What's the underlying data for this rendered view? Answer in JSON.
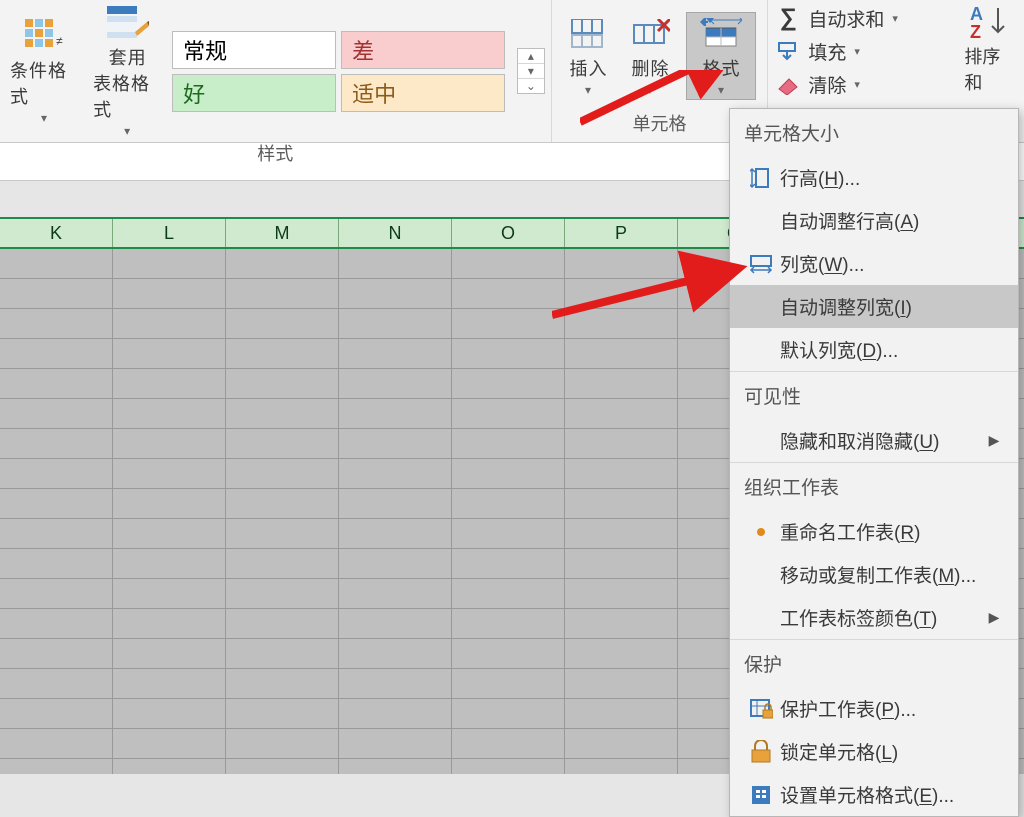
{
  "ribbon": {
    "cond_format_label": "条件格式",
    "table_format_label": "套用",
    "table_format_label2": "表格格式",
    "style_normal": "常规",
    "style_bad": "差",
    "style_good": "好",
    "style_mid": "适中",
    "styles_group_label": "样式",
    "insert_label": "插入",
    "delete_label": "删除",
    "format_label": "格式",
    "cells_group_label": "单元格",
    "autosum_label": "自动求和",
    "fill_label": "填充",
    "clear_label": "清除",
    "sort_label": "排序和"
  },
  "columns": [
    "K",
    "L",
    "M",
    "N",
    "O",
    "P",
    "Q"
  ],
  "menu": {
    "section_cellsize": "单元格大小",
    "row_height": "行高(H)...",
    "autofit_row": "自动调整行高(A)",
    "col_width": "列宽(W)...",
    "autofit_col": "自动调整列宽(I)",
    "default_width": "默认列宽(D)...",
    "section_visibility": "可见性",
    "hide_unhide": "隐藏和取消隐藏(U)",
    "section_org": "组织工作表",
    "rename_sheet": "重命名工作表(R)",
    "move_copy": "移动或复制工作表(M)...",
    "tab_color": "工作表标签颜色(T)",
    "section_protect": "保护",
    "protect_sheet": "保护工作表(P)...",
    "lock_cell": "锁定单元格(L)",
    "format_cells": "设置单元格格式(E)..."
  }
}
